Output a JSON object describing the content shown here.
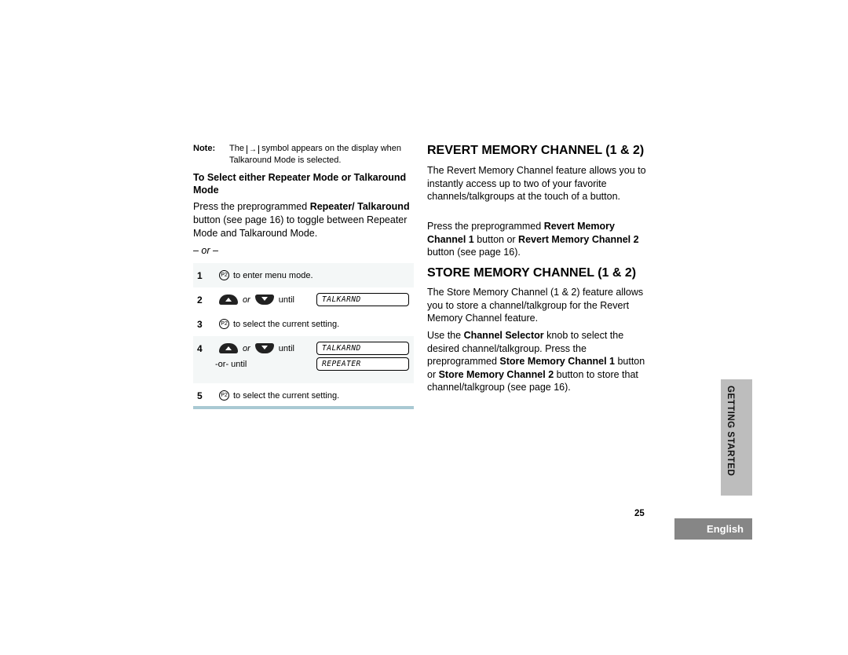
{
  "left": {
    "note_label": "Note:",
    "note_text_pre": "The",
    "note_symbol": "→",
    "note_text_post": "symbol appears on the display when Talkaround Mode is selected.",
    "subhead": "To Select either Repeater Mode or Talkaround Mode",
    "para_pre": "Press the preprogrammed ",
    "para_bold": "Repeater/ Talkaround",
    "para_post": " button (see page 16) to toggle between Repeater Mode and Talkaround Mode.",
    "or_line": "– or –",
    "steps": [
      {
        "num": "1",
        "button": "P2",
        "text": "to enter menu mode."
      },
      {
        "num": "2",
        "or": "or",
        "until": "until",
        "display": "TALKARND"
      },
      {
        "num": "3",
        "button": "P2",
        "text": "to select the current setting."
      },
      {
        "num": "4",
        "or": "or",
        "until": "until",
        "display": "TALKARND",
        "alt_text": "-or- until",
        "alt_display": "REPEATER"
      },
      {
        "num": "5",
        "button": "P2",
        "text": "to select the current setting."
      }
    ]
  },
  "right": {
    "revert": {
      "heading": "REVERT MEMORY CHANNEL (1 & 2)",
      "p1": "The Revert Memory Channel feature allows you to instantly access up to two of your favorite channels/talkgroups at the touch of a button.",
      "p2_a": "Press the preprogrammed ",
      "p2_b": "Revert Memory Channel 1",
      "p2_c": " button or ",
      "p2_d": "Revert Memory Channel 2",
      "p2_e": " button (see page 16)."
    },
    "store": {
      "heading": "STORE MEMORY CHANNEL (1 & 2)",
      "p1": "The Store Memory Channel (1 & 2) feature allows you to store a channel/talkgroup for the Revert Memory Channel feature.",
      "p2_a": "Use the ",
      "p2_b": "Channel Selector",
      "p2_c": " knob to select the desired channel/talkgroup. Press the preprogrammed ",
      "p2_d": "Store Memory Channel 1",
      "p2_e": " button or ",
      "p2_f": "Store Memory Channel 2",
      "p2_g": " button to store that channel/talkgroup (see page 16)."
    }
  },
  "side_tab": "GETTING STARTED",
  "page_number": "25",
  "language_tab": "English",
  "colors": {
    "step_rule": "#a9c9d3",
    "side_tab_bg": "#bdbdbd",
    "language_tab_bg": "#868686"
  }
}
